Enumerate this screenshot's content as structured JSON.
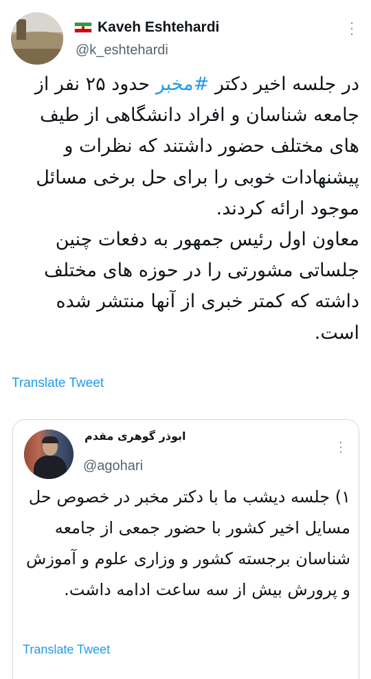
{
  "tweet": {
    "author_name": "Kaveh Eshtehardi",
    "author_flag": "iran-flag-icon",
    "handle": "@k_eshtehardi",
    "text_before_hashtag": "در جلسه اخیر دکتر ",
    "hashtag": "#مخبر",
    "text_after_hashtag": " حدود ۲۵ نفر از جامعه شناسان و افراد دانشگاهی از طیف های مختلف حضور داشتند که نظرات و پیشنهادات خوبی را برای حل برخی مسائل موجود ارائه کردند.",
    "text_paragraph_2": "معاون اول رئیس جمهور به دفعات چنین جلساتی مشورتی را در حوزه های مختلف داشته که کمتر خبری از آنها منتشر شده است.",
    "translate_label": "Translate Tweet"
  },
  "quoted_tweet": {
    "author_name": "ابوذر گوهری مقدم",
    "handle": "@agohari",
    "text": "۱) جلسه دیشب ما با دکتر مخبر در خصوص حل مسایل اخیر کشور با حضور جمعی از جامعه شناسان برجسته کشور و وزاری علوم و آموزش و پرورش بیش از سه ساعت ادامه داشت.",
    "translate_label": "Translate Tweet"
  },
  "colors": {
    "link": "#1d9bf0",
    "text": "#0f1419",
    "secondary": "#536471",
    "border": "#cfd9de"
  }
}
